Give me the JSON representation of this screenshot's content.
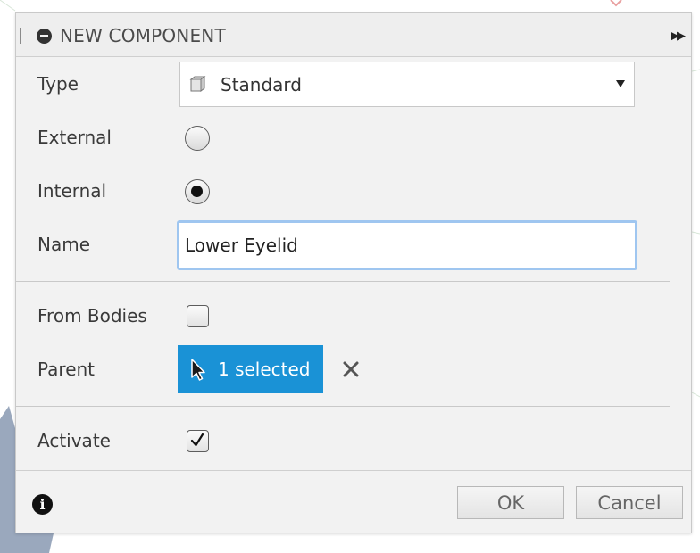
{
  "dialog": {
    "title": "NEW COMPONENT"
  },
  "form": {
    "type": {
      "label": "Type",
      "value": "Standard"
    },
    "external": {
      "label": "External",
      "checked": false
    },
    "internal": {
      "label": "Internal",
      "checked": true
    },
    "name": {
      "label": "Name",
      "value": "Lower Eyelid"
    },
    "from_bodies": {
      "label": "From Bodies",
      "checked": false
    },
    "parent": {
      "label": "Parent",
      "selection": "1 selected"
    },
    "activate": {
      "label": "Activate",
      "checked": true
    }
  },
  "footer": {
    "ok_label": "OK",
    "cancel_label": "Cancel"
  },
  "colors": {
    "selection_blue": "#1a92d6",
    "input_focus": "#9fc6f0",
    "panel_bg": "#f2f2f2"
  },
  "icons": [
    "collapse-icon",
    "expand-icon",
    "cube-icon",
    "cursor-icon",
    "close-icon",
    "info-icon",
    "checkmark-icon"
  ]
}
